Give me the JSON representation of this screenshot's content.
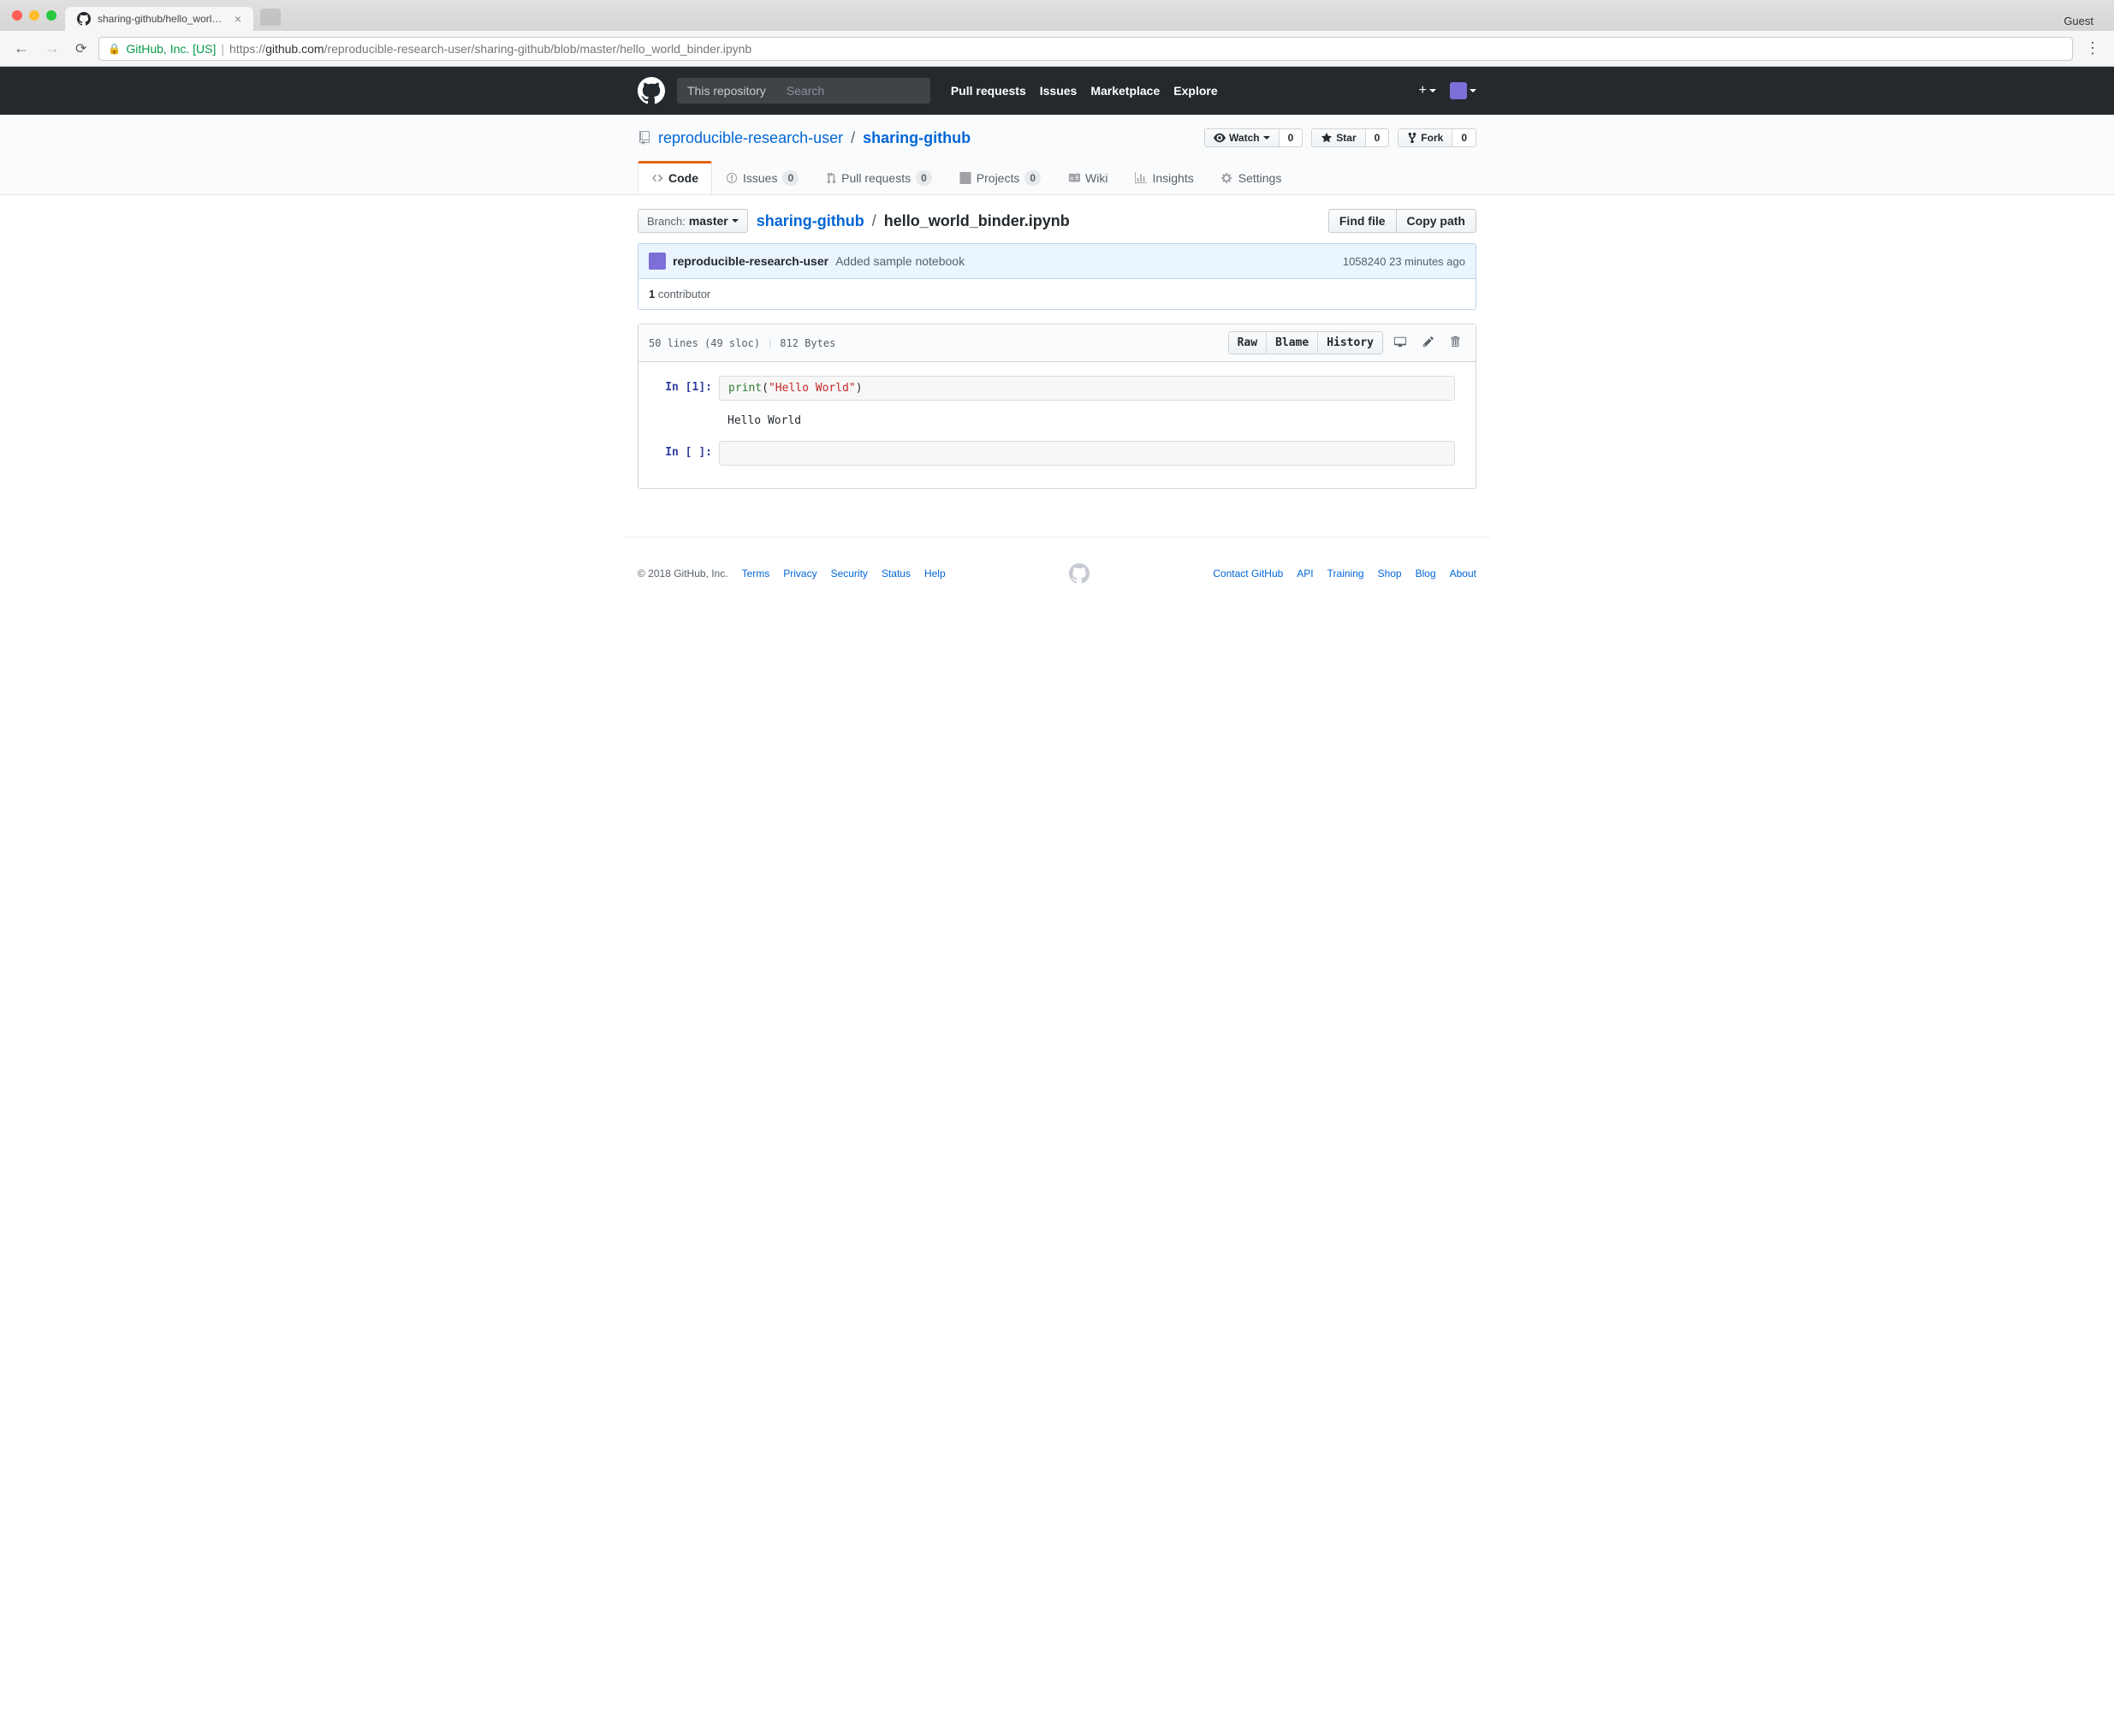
{
  "browser": {
    "tab_title": "sharing-github/hello_world_bin",
    "guest": "Guest",
    "url_org": "GitHub, Inc. [US]",
    "url_proto": "https://",
    "url_host": "github.com",
    "url_path": "/reproducible-research-user/sharing-github/blob/master/hello_world_binder.ipynb"
  },
  "header": {
    "scope": "This repository",
    "search_placeholder": "Search",
    "nav": [
      "Pull requests",
      "Issues",
      "Marketplace",
      "Explore"
    ]
  },
  "repo": {
    "owner": "reproducible-research-user",
    "name": "sharing-github",
    "actions": {
      "watch": {
        "label": "Watch",
        "count": "0"
      },
      "star": {
        "label": "Star",
        "count": "0"
      },
      "fork": {
        "label": "Fork",
        "count": "0"
      }
    },
    "tabs": {
      "code": "Code",
      "issues": "Issues",
      "issues_count": "0",
      "pulls": "Pull requests",
      "pulls_count": "0",
      "projects": "Projects",
      "projects_count": "0",
      "wiki": "Wiki",
      "insights": "Insights",
      "settings": "Settings"
    }
  },
  "file_nav": {
    "branch_prefix": "Branch:",
    "branch": "master",
    "repo_link": "sharing-github",
    "filename": "hello_world_binder.ipynb",
    "find_file": "Find file",
    "copy_path": "Copy path"
  },
  "commit": {
    "author": "reproducible-research-user",
    "message": "Added sample notebook",
    "sha": "1058240",
    "time": "23 minutes ago",
    "contributors_count": "1",
    "contributors_label": " contributor"
  },
  "file_header": {
    "lines": "50 lines (49 sloc)",
    "size": "812 Bytes",
    "raw": "Raw",
    "blame": "Blame",
    "history": "History"
  },
  "notebook": {
    "cell1": {
      "prompt": "In [1]:",
      "func": "print",
      "open": "(",
      "str": "\"Hello World\"",
      "close": ")"
    },
    "out1": {
      "text": "Hello World"
    },
    "cell2": {
      "prompt": "In [ ]:"
    }
  },
  "footer": {
    "copyright": "© 2018 GitHub, Inc.",
    "left": [
      "Terms",
      "Privacy",
      "Security",
      "Status",
      "Help"
    ],
    "right": [
      "Contact GitHub",
      "API",
      "Training",
      "Shop",
      "Blog",
      "About"
    ]
  }
}
